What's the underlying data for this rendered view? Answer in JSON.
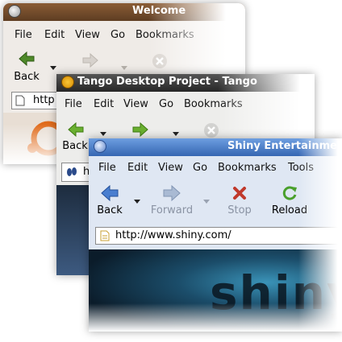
{
  "windows": {
    "ubuntu": {
      "title": "Welcome",
      "menu": [
        "File",
        "Edit",
        "View",
        "Go",
        "Bookmarks"
      ],
      "toolbar": {
        "back": "Back"
      },
      "url": "http"
    },
    "tango": {
      "title": "Tango Desktop Project - Tango",
      "menu": [
        "File",
        "Edit",
        "View",
        "Go",
        "Bookmarks"
      ],
      "toolbar": {
        "back": "Back"
      },
      "url_fragment": "h"
    },
    "shiny": {
      "title": "Shiny Entertainment",
      "menu": [
        "File",
        "Edit",
        "View",
        "Go",
        "Bookmarks",
        "Tools"
      ],
      "toolbar": {
        "back": "Back",
        "forward": "Forward",
        "stop": "Stop",
        "reload": "Reload"
      },
      "url": "http://www.shiny.com/",
      "page_logo_text": "shiny"
    }
  },
  "colors": {
    "ubuntu_titlebar": "#6e4a2c",
    "tango_titlebar": "#3a3a3a",
    "shiny_titlebar": "#4a7fc9",
    "shiny_chrome": "#d9e3f1",
    "back_arrow_blue": "#3b6fc4",
    "stop_red": "#c0392b",
    "reload_green": "#4aa02c",
    "tango_arrow_green": "#6ab030"
  }
}
